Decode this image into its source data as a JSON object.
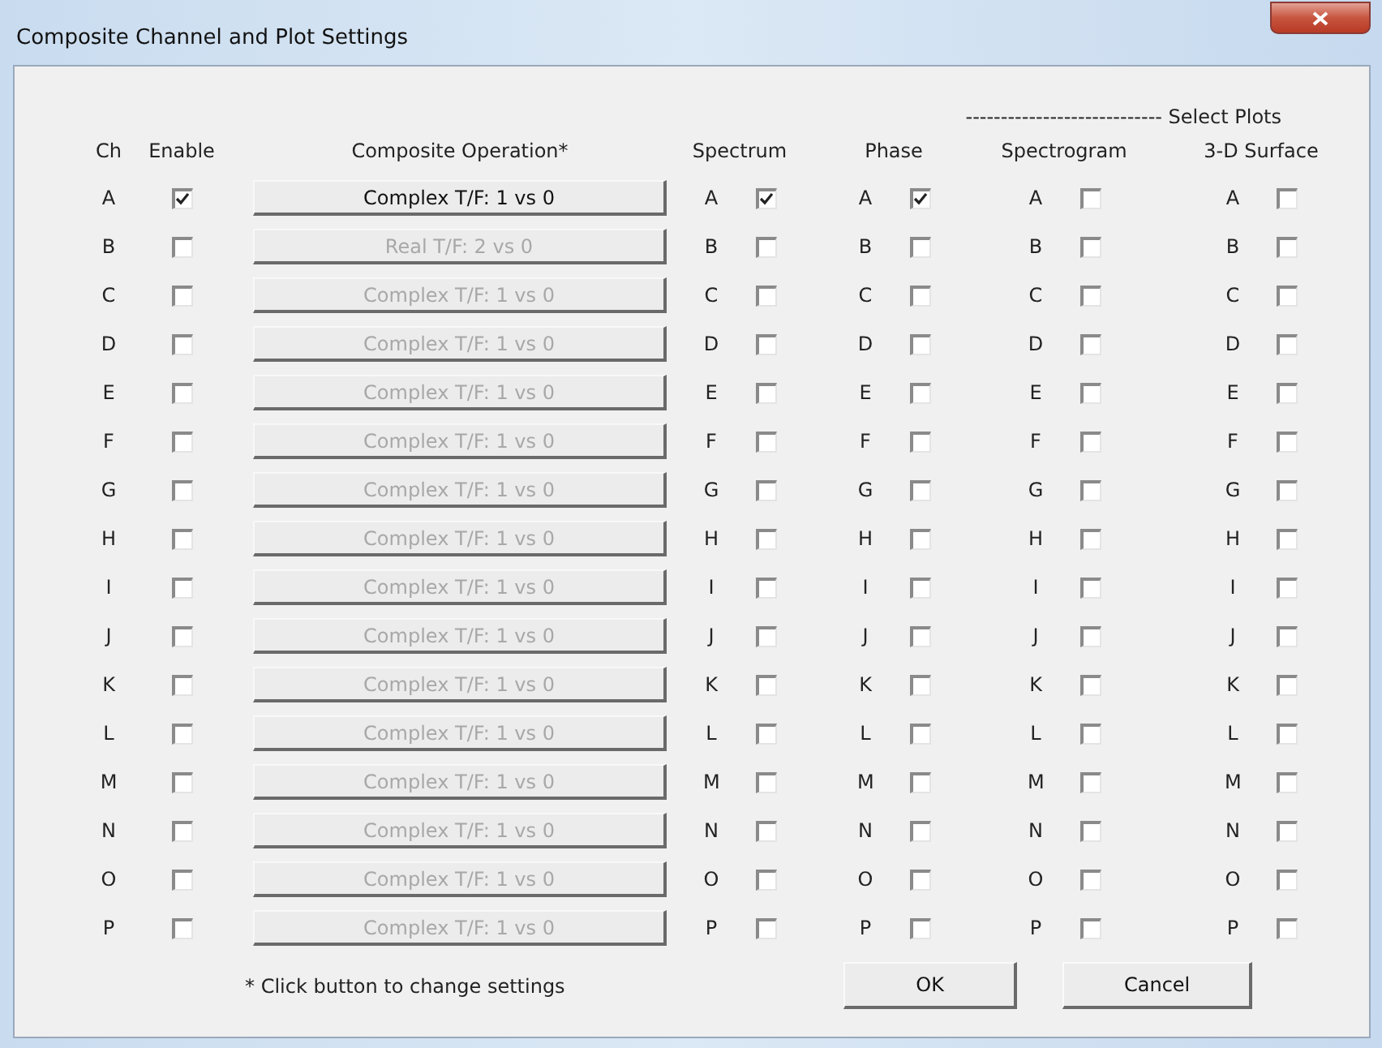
{
  "window": {
    "title": "Composite Channel and Plot Settings"
  },
  "select_plots_label": "---------------------------- Select Plots",
  "headers": [
    "Ch",
    "Enable",
    "Composite Operation*",
    "Spectrum",
    "Phase",
    "Spectrogram",
    "3-D Surface"
  ],
  "rows": [
    {
      "ch": "A",
      "enabled": true,
      "operation": {
        "label": "Complex T/F: 1 vs 0",
        "disabled": false
      },
      "plots": [
        {
          "label": "A",
          "checked": true
        },
        {
          "label": "A",
          "checked": true
        },
        {
          "label": "A",
          "checked": false
        },
        {
          "label": "A",
          "checked": false
        }
      ]
    },
    {
      "ch": "B",
      "enabled": false,
      "operation": {
        "label": "Real T/F: 2 vs 0",
        "disabled": true
      },
      "plots": [
        {
          "label": "B",
          "checked": false
        },
        {
          "label": "B",
          "checked": false
        },
        {
          "label": "B",
          "checked": false
        },
        {
          "label": "B",
          "checked": false
        }
      ]
    },
    {
      "ch": "C",
      "enabled": false,
      "operation": {
        "label": "Complex T/F: 1 vs 0",
        "disabled": true
      },
      "plots": [
        {
          "label": "C",
          "checked": false
        },
        {
          "label": "C",
          "checked": false
        },
        {
          "label": "C",
          "checked": false
        },
        {
          "label": "C",
          "checked": false
        }
      ]
    },
    {
      "ch": "D",
      "enabled": false,
      "operation": {
        "label": "Complex T/F: 1 vs 0",
        "disabled": true
      },
      "plots": [
        {
          "label": "D",
          "checked": false
        },
        {
          "label": "D",
          "checked": false
        },
        {
          "label": "D",
          "checked": false
        },
        {
          "label": "D",
          "checked": false
        }
      ]
    },
    {
      "ch": "E",
      "enabled": false,
      "operation": {
        "label": "Complex T/F: 1 vs 0",
        "disabled": true
      },
      "plots": [
        {
          "label": "E",
          "checked": false
        },
        {
          "label": "E",
          "checked": false
        },
        {
          "label": "E",
          "checked": false
        },
        {
          "label": "E",
          "checked": false
        }
      ]
    },
    {
      "ch": "F",
      "enabled": false,
      "operation": {
        "label": "Complex T/F: 1 vs 0",
        "disabled": true
      },
      "plots": [
        {
          "label": "F",
          "checked": false
        },
        {
          "label": "F",
          "checked": false
        },
        {
          "label": "F",
          "checked": false
        },
        {
          "label": "F",
          "checked": false
        }
      ]
    },
    {
      "ch": "G",
      "enabled": false,
      "operation": {
        "label": "Complex T/F: 1 vs 0",
        "disabled": true
      },
      "plots": [
        {
          "label": "G",
          "checked": false
        },
        {
          "label": "G",
          "checked": false
        },
        {
          "label": "G",
          "checked": false
        },
        {
          "label": "G",
          "checked": false
        }
      ]
    },
    {
      "ch": "H",
      "enabled": false,
      "operation": {
        "label": "Complex T/F: 1 vs 0",
        "disabled": true
      },
      "plots": [
        {
          "label": "H",
          "checked": false
        },
        {
          "label": "H",
          "checked": false
        },
        {
          "label": "H",
          "checked": false
        },
        {
          "label": "H",
          "checked": false
        }
      ]
    },
    {
      "ch": "I",
      "enabled": false,
      "operation": {
        "label": "Complex T/F: 1 vs 0",
        "disabled": true
      },
      "plots": [
        {
          "label": "I",
          "checked": false
        },
        {
          "label": "I",
          "checked": false
        },
        {
          "label": "I",
          "checked": false
        },
        {
          "label": "I",
          "checked": false
        }
      ]
    },
    {
      "ch": "J",
      "enabled": false,
      "operation": {
        "label": "Complex T/F: 1 vs 0",
        "disabled": true
      },
      "plots": [
        {
          "label": "J",
          "checked": false
        },
        {
          "label": "J",
          "checked": false
        },
        {
          "label": "J",
          "checked": false
        },
        {
          "label": "J",
          "checked": false
        }
      ]
    },
    {
      "ch": "K",
      "enabled": false,
      "operation": {
        "label": "Complex T/F: 1 vs 0",
        "disabled": true
      },
      "plots": [
        {
          "label": "K",
          "checked": false
        },
        {
          "label": "K",
          "checked": false
        },
        {
          "label": "K",
          "checked": false
        },
        {
          "label": "K",
          "checked": false
        }
      ]
    },
    {
      "ch": "L",
      "enabled": false,
      "operation": {
        "label": "Complex T/F: 1 vs 0",
        "disabled": true
      },
      "plots": [
        {
          "label": "L",
          "checked": false
        },
        {
          "label": "L",
          "checked": false
        },
        {
          "label": "L",
          "checked": false
        },
        {
          "label": "L",
          "checked": false
        }
      ]
    },
    {
      "ch": "M",
      "enabled": false,
      "operation": {
        "label": "Complex T/F: 1 vs 0",
        "disabled": true
      },
      "plots": [
        {
          "label": "M",
          "checked": false
        },
        {
          "label": "M",
          "checked": false
        },
        {
          "label": "M",
          "checked": false
        },
        {
          "label": "M",
          "checked": false
        }
      ]
    },
    {
      "ch": "N",
      "enabled": false,
      "operation": {
        "label": "Complex T/F: 1 vs 0",
        "disabled": true
      },
      "plots": [
        {
          "label": "N",
          "checked": false
        },
        {
          "label": "N",
          "checked": false
        },
        {
          "label": "N",
          "checked": false
        },
        {
          "label": "N",
          "checked": false
        }
      ]
    },
    {
      "ch": "O",
      "enabled": false,
      "operation": {
        "label": "Complex T/F: 1 vs 0",
        "disabled": true
      },
      "plots": [
        {
          "label": "O",
          "checked": false
        },
        {
          "label": "O",
          "checked": false
        },
        {
          "label": "O",
          "checked": false
        },
        {
          "label": "O",
          "checked": false
        }
      ]
    },
    {
      "ch": "P",
      "enabled": false,
      "operation": {
        "label": "Complex T/F: 1 vs 0",
        "disabled": true
      },
      "plots": [
        {
          "label": "P",
          "checked": false
        },
        {
          "label": "P",
          "checked": false
        },
        {
          "label": "P",
          "checked": false
        },
        {
          "label": "P",
          "checked": false
        }
      ]
    }
  ],
  "footnote": "* Click button to change settings",
  "buttons": [
    "OK",
    "Cancel"
  ]
}
